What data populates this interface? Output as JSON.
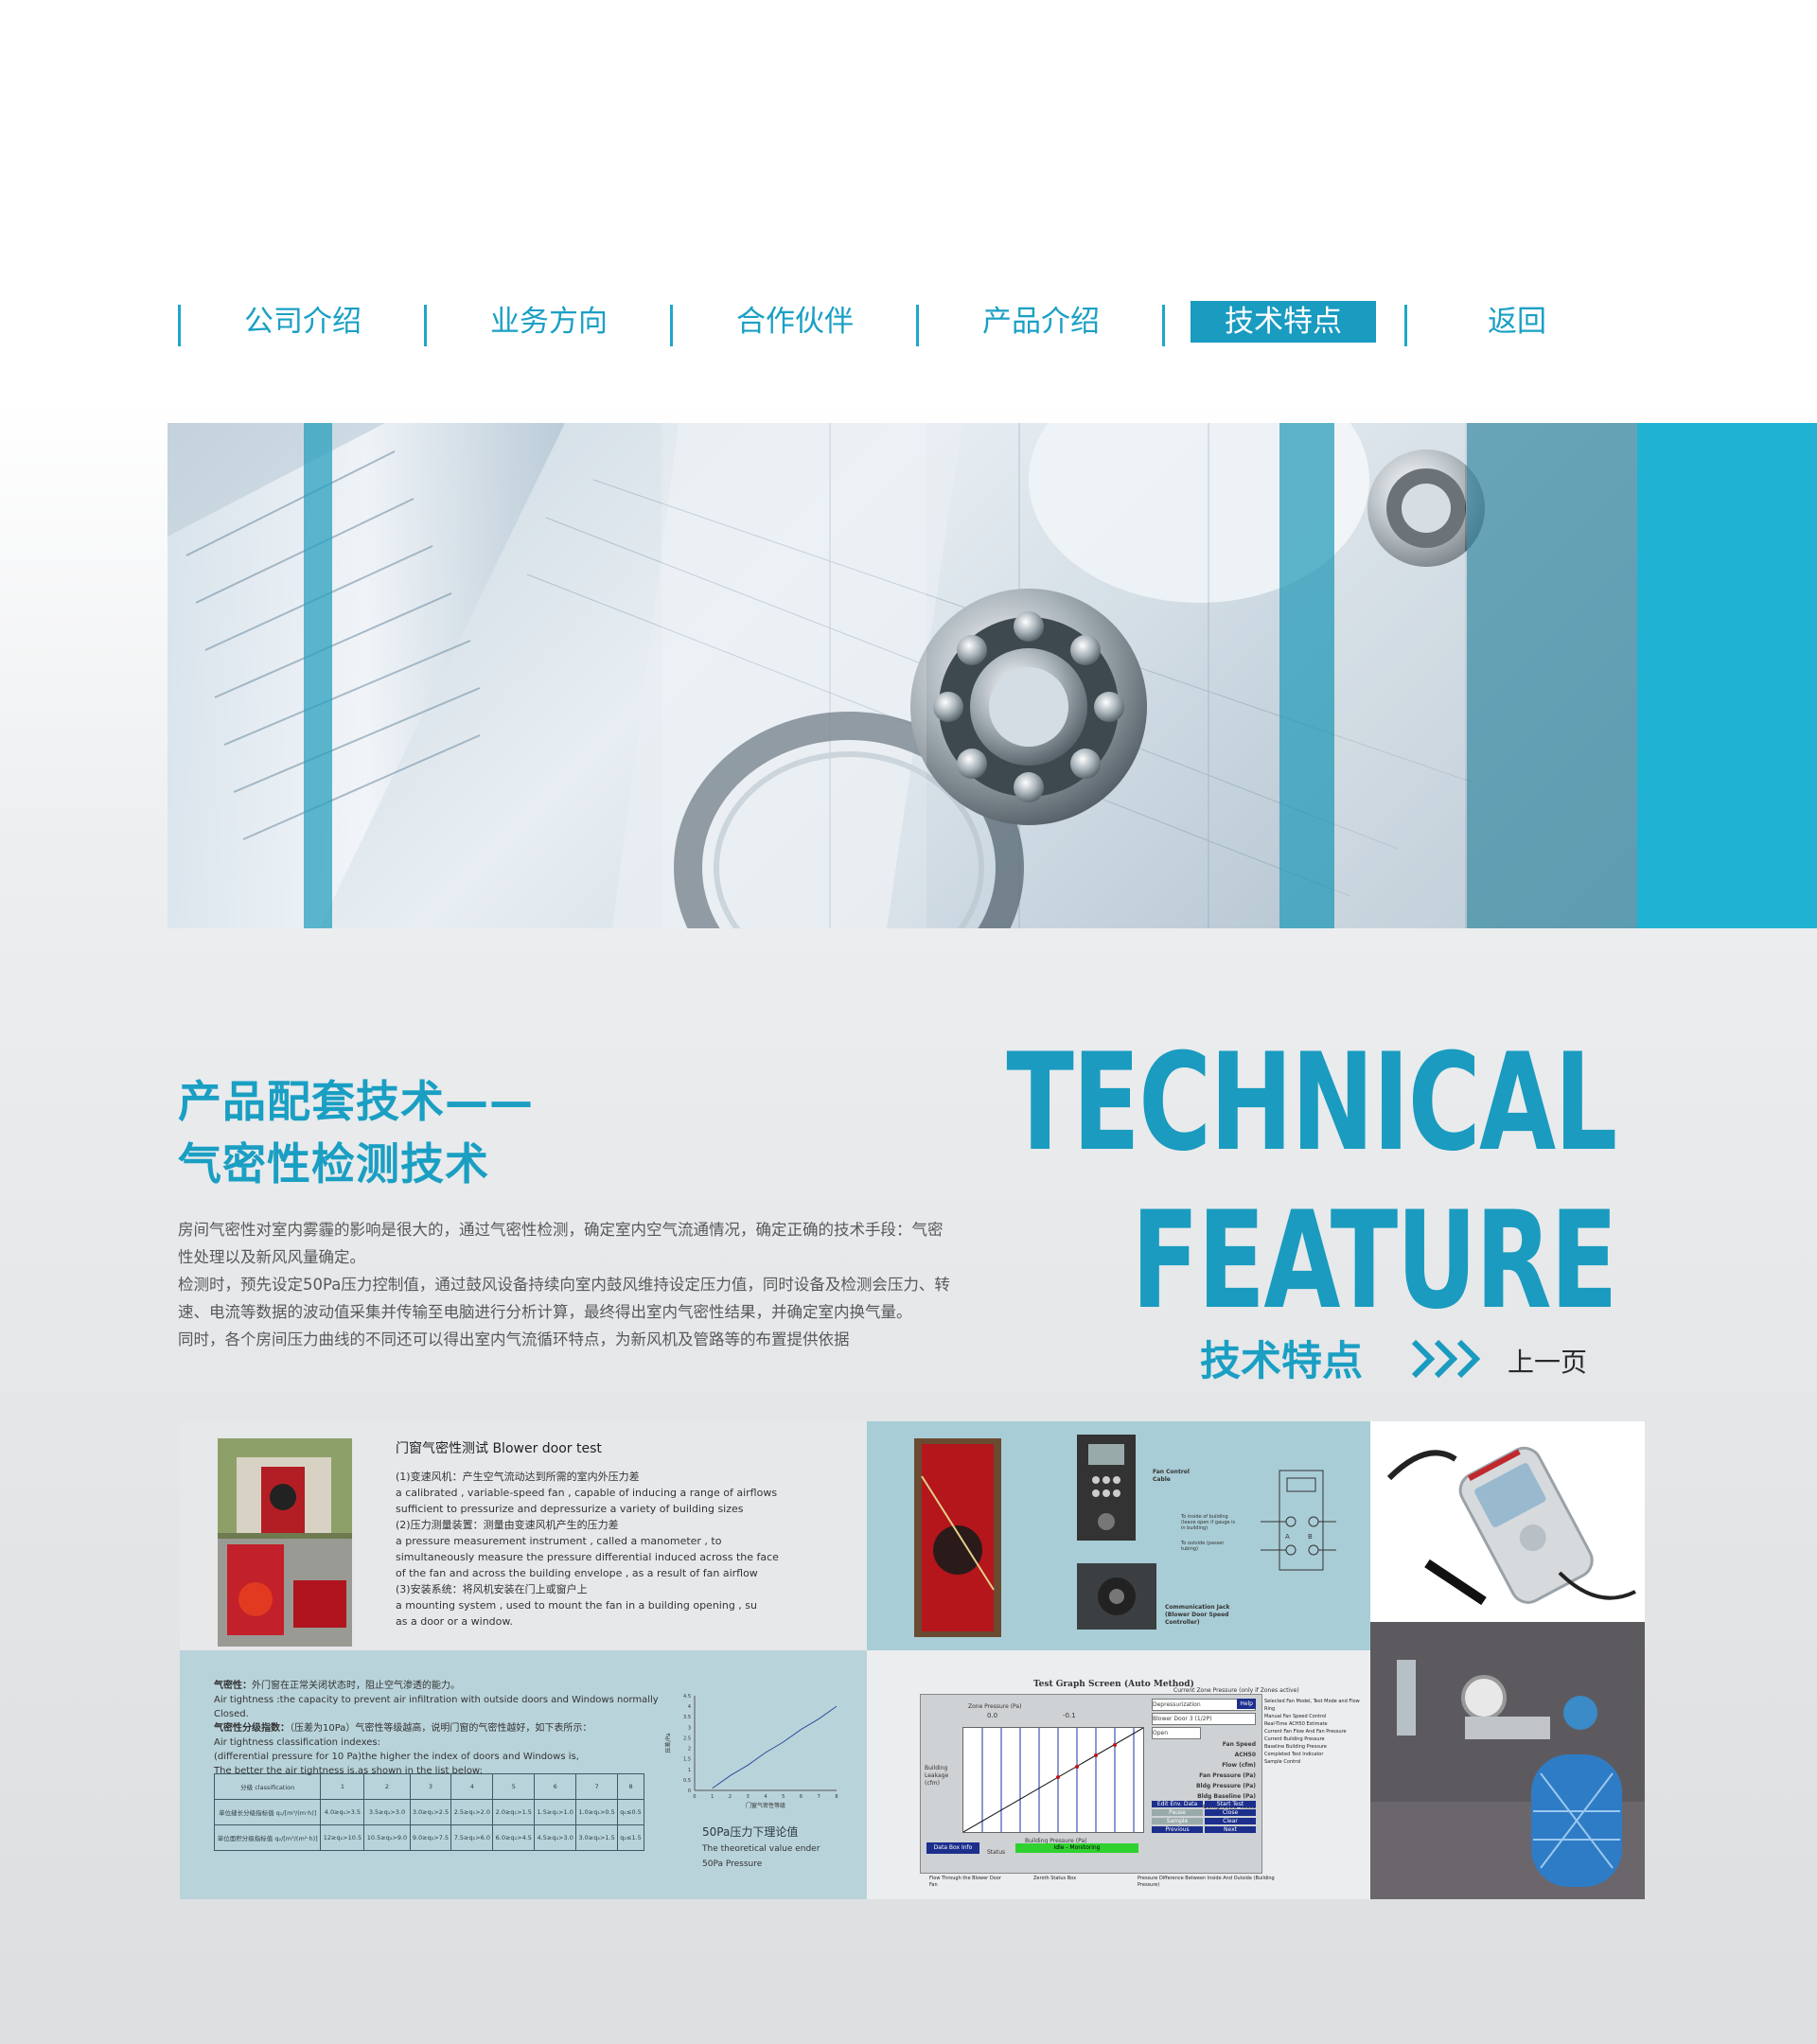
{
  "nav": {
    "items": [
      {
        "label": "公司介绍",
        "active": false
      },
      {
        "label": "业务方向",
        "active": false
      },
      {
        "label": "合作伙伴",
        "active": false
      },
      {
        "label": "产品介绍",
        "active": false
      },
      {
        "label": "技术特点",
        "active": true
      },
      {
        "label": "返回",
        "active": false
      }
    ]
  },
  "colors": {
    "accent": "#1a9bc0",
    "banner_stripe": "#1fb2d3"
  },
  "section": {
    "title_line1": "产品配套技术——",
    "title_line2": "气密性检测技术",
    "intro": [
      "房间气密性对室内雾霾的影响是很大的，通过气密性检测，确定室内空气流通情况，确定正确的技术手段：气密",
      "性处理以及新风风量确定。",
      "检测时，预先设定50Pa压力控制值，通过鼓风设备持续向室内鼓风维持设定压力值，同时设备及检测会压力、转",
      "速、电流等数据的波动值采集并传输至电脑进行分析计算，最终得出室内气密性结果，并确定室内换气量。",
      "同时，各个房间压力曲线的不同还可以得出室内气流循环特点，为新风机及管路等的布置提供依据"
    ],
    "big_title_1": "TECHNICAL",
    "big_title_2": "FEATURE",
    "subtitle_cn": "技术特点",
    "prev_link": "上一页"
  },
  "blower_panel": {
    "title": "门窗气密性测试 Blower door test",
    "lines": [
      "(1)变速风机：产生空气流动达到所需的室内外压力差",
      "a calibrated , variable-speed fan , capable of inducing a range of airflows",
      "sufficient to pressurize and depressurize a variety of building sizes",
      "(2)压力测量装置：测量由变速风机产生的压力差",
      "a pressure measurement instrument , called a manometer , to",
      "simultaneously measure the pressure differential induced across the face",
      "of the fan and across the building envelope , as a result of fan airflow",
      "(3)安装系统：将风机安装在门上或窗户上",
      "a mounting system , used to mount the fan in a building opening , su",
      "as a door or a window."
    ]
  },
  "diagram_panel": {
    "fan_label": "Fan Control Cable",
    "jack_label": "Communication Jack (Blower Door Speed Controller)",
    "note1": "To inside of building (leave open if gauge is in building)",
    "note2": "To outside (passer tubing)",
    "port_a": "A",
    "port_b": "B"
  },
  "airtight_panel": {
    "def_head": "气密性：",
    "def_cn": "外门窗在正常关闭状态时，阻止空气渗透的能力。",
    "def_en": "Air tightness :the capacity to prevent air infiltration with outside doors and Windows normally Closed.",
    "idx_head": "气密性分级指数：",
    "idx_cn": "（压差为10Pa）气密性等级越高，说明门窗的气密性越好，如下表所示：",
    "idx_en1": "Air tightness classification indexes:",
    "idx_en2": "(differential pressure for 10 Pa)the higher the index of doors and Windows is,",
    "idx_en3": "The better the air tightness is.as shown in the list below:",
    "table": {
      "header": [
        "分级 classification",
        "1",
        "2",
        "3",
        "4",
        "5",
        "6",
        "7",
        "8"
      ],
      "row1": [
        "单位缝长分级指标值 q₁/[m³/(m·h)]",
        "4.0≥q₁>3.5",
        "3.5≥q₁>3.0",
        "3.0≥q₁>2.5",
        "2.5≥q₁>2.0",
        "2.0≥q₁>1.5",
        "1.5≥q₁>1.0",
        "1.0≥q₁>0.5",
        "q₁≤0.5"
      ],
      "row2": [
        "单位面积分级指标值 q₂/[m³/(m²·h)]",
        "12≥q₂>10.5",
        "10.5≥q₂>9.0",
        "9.0≥q₂>7.5",
        "7.5≥q₂>6.0",
        "6.0≥q₂>4.5",
        "4.5≥q₂>3.0",
        "3.0≥q₂>1.5",
        "q₂≤1.5"
      ]
    },
    "chart_title": "50Pa压力下理论值",
    "chart_sub1": "The theoretical value ender",
    "chart_sub2": "50Pa Pressure",
    "chart_xlabel": "门窗气密性等级",
    "chart_ylabel": "压差/Pa"
  },
  "chart_data": {
    "type": "line",
    "x": [
      1,
      2,
      3,
      4,
      5,
      6,
      7,
      8
    ],
    "y_ticks": [
      "4.5",
      "4",
      "3.5",
      "3",
      "2.5",
      "2",
      "1.5",
      "1",
      "0.5",
      "0"
    ],
    "x_ticks": [
      "0",
      "1",
      "2",
      "3",
      "4",
      "5",
      "6",
      "7",
      "8"
    ],
    "series": [
      {
        "values": [
          0.1,
          0.7,
          1.2,
          1.8,
          2.3,
          2.9,
          3.4,
          4.0
        ]
      }
    ],
    "ylim": [
      0,
      4.5
    ],
    "xlim": [
      0,
      8
    ],
    "grid": false
  },
  "screen_panel": {
    "title": "Test Graph Screen (Auto Method)",
    "top_note": "Current Zone Pressure (only if Zones active)",
    "zone_label": "Zone Pressure (Pa)",
    "zone_value": "0.0",
    "fan_value": "-0.1",
    "left_axis": "Building Leakage (cfm)",
    "bottom_axis": "Building Pressure (Pa)",
    "btn_data": "Data Box Info",
    "status_label": "Status",
    "status_value": "Idle - Monitoring",
    "dropdowns": [
      "Depressurization",
      "Blower Door 3 (1/2P)",
      "Open"
    ],
    "help": "Help",
    "fields": [
      "Fan Speed",
      "ACH50",
      "Flow (cfm)",
      "Fan Pressure (Pa)",
      "Bldg Pressure (Pa)",
      "Bldg Baseline (Pa)",
      "Completed Tests"
    ],
    "buttons": [
      "Edit Env. Data",
      "Start Test",
      "Pause",
      "Close",
      "Sample",
      "Clear",
      "Previous",
      "Next"
    ],
    "bottom_notes": [
      "Flow Through the Blower Door Fan",
      "Zeroth Status Box",
      "Pressure Difference Between Inside And Outside (Building Pressure)"
    ],
    "right_notes": [
      "Selected Fan Model, Test Mode and Flow Ring",
      "Manual Fan Speed Control",
      "Real-Time ACH50 Estimate",
      "Current Fan Flow And Fan Pressure",
      "Current Building Pressure",
      "Baseline Building Pressure",
      "Completed Test Indicator",
      "Sample Control"
    ]
  }
}
